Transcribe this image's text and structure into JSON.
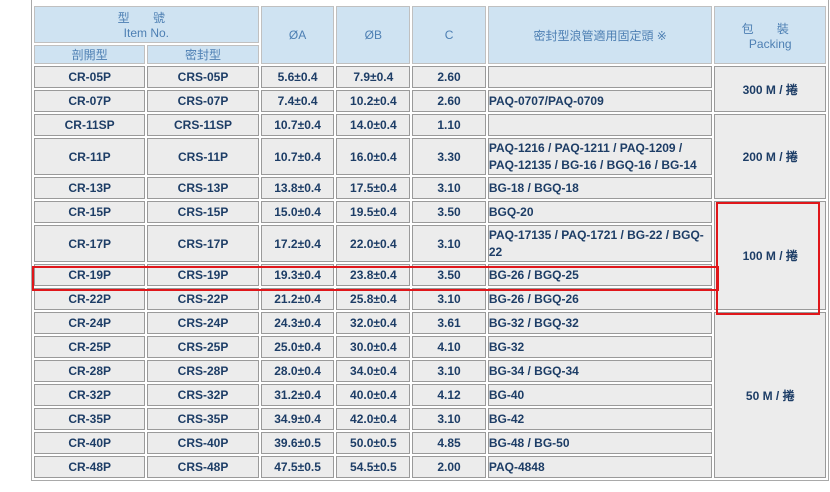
{
  "header": {
    "item_zh": "型 號",
    "item_en": "Item No.",
    "split_type": "剖開型",
    "sealed_type": "密封型",
    "dia_a": "ØA",
    "dia_b": "ØB",
    "c": "C",
    "fitting": "密封型浪管適用固定頭 ※",
    "packing_zh": "包 裝",
    "packing_en": "Packing"
  },
  "rows": [
    {
      "split": "CR-05P",
      "sealed": "CRS-05P",
      "a": "5.6±0.4",
      "b": "7.9±0.4",
      "c": "2.60",
      "fit": ""
    },
    {
      "split": "CR-07P",
      "sealed": "CRS-07P",
      "a": "7.4±0.4",
      "b": "10.2±0.4",
      "c": "2.60",
      "fit": "PAQ-0707/PAQ-0709"
    },
    {
      "split": "CR-11SP",
      "sealed": "CRS-11SP",
      "a": "10.7±0.4",
      "b": "14.0±0.4",
      "c": "1.10",
      "fit": ""
    },
    {
      "split": "CR-11P",
      "sealed": "CRS-11P",
      "a": "10.7±0.4",
      "b": "16.0±0.4",
      "c": "3.30",
      "fit": "PAQ-1216 / PAQ-1211 / PAQ-1209 / PAQ-12135 / BG-16 / BGQ-16 / BG-14"
    },
    {
      "split": "CR-13P",
      "sealed": "CRS-13P",
      "a": "13.8±0.4",
      "b": "17.5±0.4",
      "c": "3.10",
      "fit": "BG-18 / BGQ-18"
    },
    {
      "split": "CR-15P",
      "sealed": "CRS-15P",
      "a": "15.0±0.4",
      "b": "19.5±0.4",
      "c": "3.50",
      "fit": "BGQ-20"
    },
    {
      "split": "CR-17P",
      "sealed": "CRS-17P",
      "a": "17.2±0.4",
      "b": "22.0±0.4",
      "c": "3.10",
      "fit": "PAQ-17135 / PAQ-1721 / BG-22 / BGQ-22"
    },
    {
      "split": "CR-19P",
      "sealed": "CRS-19P",
      "a": "19.3±0.4",
      "b": "23.8±0.4",
      "c": "3.50",
      "fit": "BG-26 / BGQ-25"
    },
    {
      "split": "CR-22P",
      "sealed": "CRS-22P",
      "a": "21.2±0.4",
      "b": "25.8±0.4",
      "c": "3.10",
      "fit": "BG-26 / BGQ-26"
    },
    {
      "split": "CR-24P",
      "sealed": "CRS-24P",
      "a": "24.3±0.4",
      "b": "32.0±0.4",
      "c": "3.61",
      "fit": "BG-32 / BGQ-32"
    },
    {
      "split": "CR-25P",
      "sealed": "CRS-25P",
      "a": "25.0±0.4",
      "b": "30.0±0.4",
      "c": "4.10",
      "fit": "BG-32"
    },
    {
      "split": "CR-28P",
      "sealed": "CRS-28P",
      "a": "28.0±0.4",
      "b": "34.0±0.4",
      "c": "3.10",
      "fit": "BG-34 / BGQ-34"
    },
    {
      "split": "CR-32P",
      "sealed": "CRS-32P",
      "a": "31.2±0.4",
      "b": "40.0±0.4",
      "c": "4.12",
      "fit": "BG-40"
    },
    {
      "split": "CR-35P",
      "sealed": "CRS-35P",
      "a": "34.9±0.4",
      "b": "42.0±0.4",
      "c": "3.10",
      "fit": "BG-42"
    },
    {
      "split": "CR-40P",
      "sealed": "CRS-40P",
      "a": "39.6±0.5",
      "b": "50.0±0.5",
      "c": "4.85",
      "fit": "BG-48 / BG-50"
    },
    {
      "split": "CR-48P",
      "sealed": "CRS-48P",
      "a": "47.5±0.5",
      "b": "54.5±0.5",
      "c": "2.00",
      "fit": "PAQ-4848"
    }
  ],
  "packing": [
    "300 M / 捲",
    "200 M / 捲",
    "100 M / 捲",
    "50 M / 捲"
  ],
  "colors": {
    "highlight": "#e0161a",
    "header_bg": "#cfe3f2",
    "cell_bg": "#ececec",
    "text": "#1d3d66"
  }
}
